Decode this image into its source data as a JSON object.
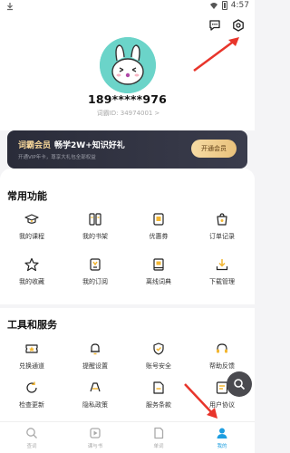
{
  "status_bar": {
    "time": "4:57"
  },
  "profile": {
    "username": "189*****976",
    "user_id": "词霸ID: 34974001",
    "user_id_chevron": ">"
  },
  "vip_banner": {
    "title_highlight": "词霸会员",
    "title_rest": "畅学2W+知识好礼",
    "subtitle": "开通VIP年卡，尊享大礼包全部权益",
    "button_label": "开通会员"
  },
  "common_functions": {
    "title": "常用功能",
    "items": [
      {
        "label": "我的课程",
        "icon": "graduation-cap-icon"
      },
      {
        "label": "我的书架",
        "icon": "bookshelf-icon"
      },
      {
        "label": "优惠券",
        "icon": "coupon-icon"
      },
      {
        "label": "订单记录",
        "icon": "order-bag-icon"
      },
      {
        "label": "我的收藏",
        "icon": "star-icon"
      },
      {
        "label": "我的订阅",
        "icon": "subscription-icon"
      },
      {
        "label": "离线词典",
        "icon": "offline-dictionary-icon"
      },
      {
        "label": "下载管理",
        "icon": "download-icon"
      }
    ]
  },
  "tools_services": {
    "title": "工具和服务",
    "items": [
      {
        "label": "兑换通道",
        "icon": "exchange-ticket-icon"
      },
      {
        "label": "提醒设置",
        "icon": "bell-icon"
      },
      {
        "label": "账号安全",
        "icon": "shield-icon"
      },
      {
        "label": "帮助反馈",
        "icon": "headset-icon"
      },
      {
        "label": "检查更新",
        "icon": "refresh-icon"
      },
      {
        "label": "隐私政策",
        "icon": "privacy-icon"
      },
      {
        "label": "服务条款",
        "icon": "document-icon"
      },
      {
        "label": "用户协议",
        "icon": "user-agreement-icon"
      }
    ]
  },
  "bottom_nav": {
    "tabs": [
      {
        "label": "查词",
        "icon": "search-icon"
      },
      {
        "label": "课与书",
        "icon": "play-book-icon"
      },
      {
        "label": "单词",
        "icon": "word-card-icon"
      },
      {
        "label": "我的",
        "icon": "person-icon"
      }
    ],
    "active_index": 3
  },
  "colors": {
    "accent_yellow": "#f2b632",
    "active_blue": "#1e9ee0",
    "annotation_red": "#e8352b",
    "vip_gold": "#f6d69a"
  }
}
